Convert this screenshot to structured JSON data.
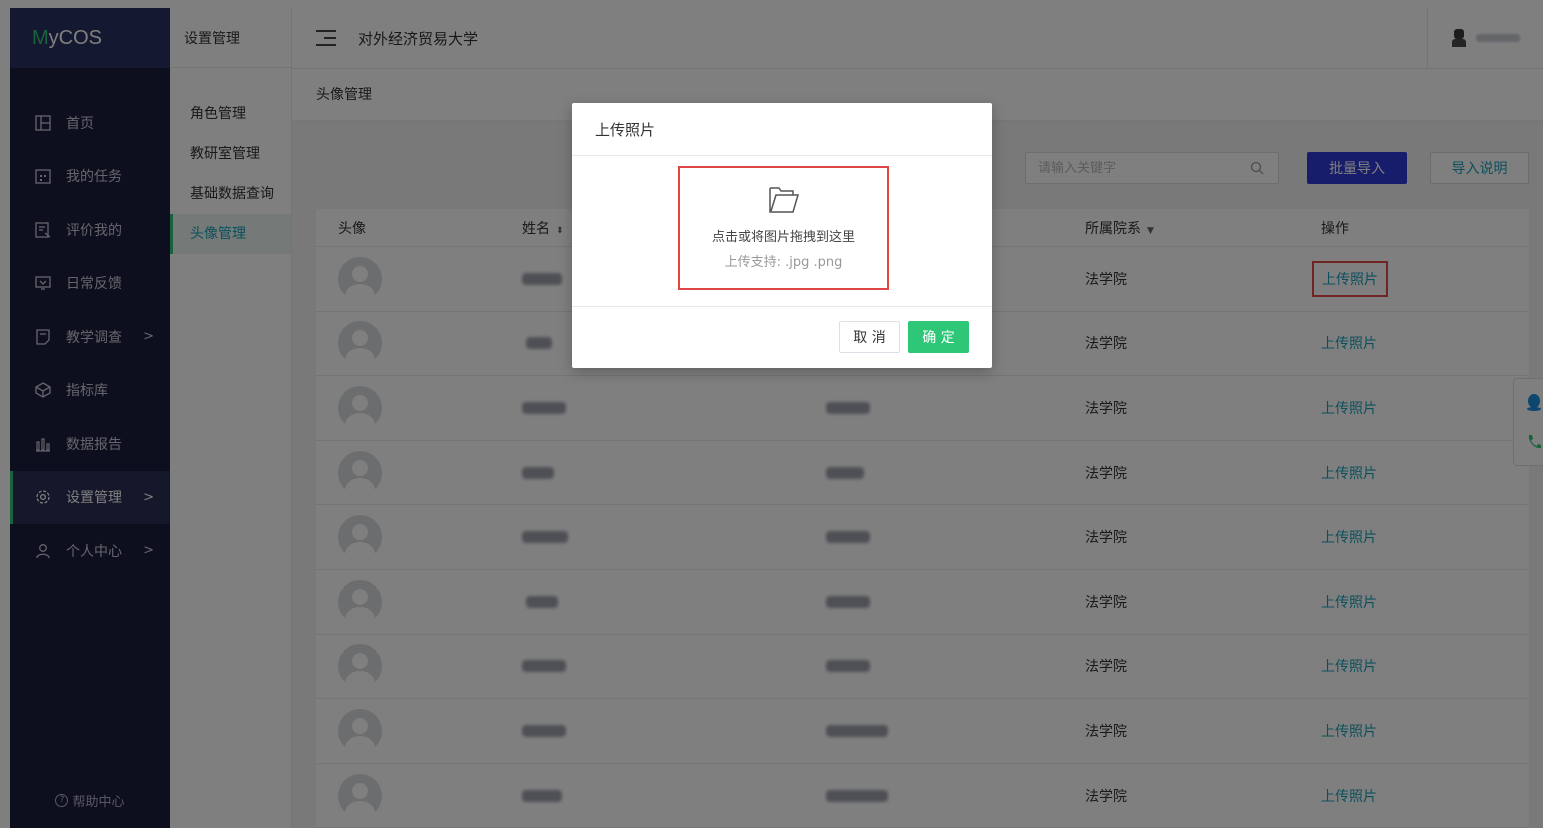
{
  "app": {
    "logo_prefix": "M",
    "logo_rest": "yCOS"
  },
  "sidebar": {
    "items": [
      {
        "label": "首页",
        "icon": "layout-icon",
        "arrow": ""
      },
      {
        "label": "我的任务",
        "icon": "calendar-icon",
        "arrow": ""
      },
      {
        "label": "评价我的",
        "icon": "evaluate-icon",
        "arrow": ""
      },
      {
        "label": "日常反馈",
        "icon": "feedback-icon",
        "arrow": ""
      },
      {
        "label": "教学调查",
        "icon": "survey-icon",
        "arrow": ">"
      },
      {
        "label": "指标库",
        "icon": "cube-icon",
        "arrow": ""
      },
      {
        "label": "数据报告",
        "icon": "bar-chart-icon",
        "arrow": ""
      },
      {
        "label": "设置管理",
        "icon": "gear-icon",
        "arrow": ">",
        "active": true
      },
      {
        "label": "个人中心",
        "icon": "user-icon",
        "arrow": ">"
      }
    ],
    "help_label": "帮助中心"
  },
  "subnav": {
    "title": "设置管理",
    "items": [
      {
        "label": "角色管理"
      },
      {
        "label": "教研室管理"
      },
      {
        "label": "基础数据查询"
      },
      {
        "label": "头像管理",
        "active": true
      }
    ]
  },
  "header": {
    "school": "对外经济贸易大学"
  },
  "breadcrumb": {
    "current": "头像管理"
  },
  "toolbar": {
    "search_placeholder": "请输入关键字",
    "import_label": "批量导入",
    "help_label": "导入说明"
  },
  "table": {
    "columns": {
      "avatar": "头像",
      "name": "姓名",
      "dept": "",
      "college": "所属院系",
      "op": "操作"
    },
    "rows": [
      {
        "college": "法学院",
        "action": "上传照片"
      },
      {
        "college": "法学院",
        "action": "上传照片"
      },
      {
        "college": "法学院",
        "action": "上传照片"
      },
      {
        "college": "法学院",
        "action": "上传照片"
      },
      {
        "college": "法学院",
        "action": "上传照片"
      },
      {
        "college": "法学院",
        "action": "上传照片"
      },
      {
        "college": "法学院",
        "action": "上传照片"
      },
      {
        "college": "法学院",
        "action": "上传照片"
      },
      {
        "college": "法学院",
        "action": "上传照片"
      }
    ]
  },
  "modal": {
    "title": "上传照片",
    "drop_text": "点击或将图片拖拽到这里",
    "support_text": "上传支持: .jpg .png",
    "cancel_label": "取 消",
    "ok_label": "确 定"
  },
  "colors": {
    "accent": "#2ec778",
    "link": "#1aa0b8",
    "primary": "#2f3ad6",
    "sidebar": "#1c1f3c",
    "highlight": "#e04848"
  }
}
